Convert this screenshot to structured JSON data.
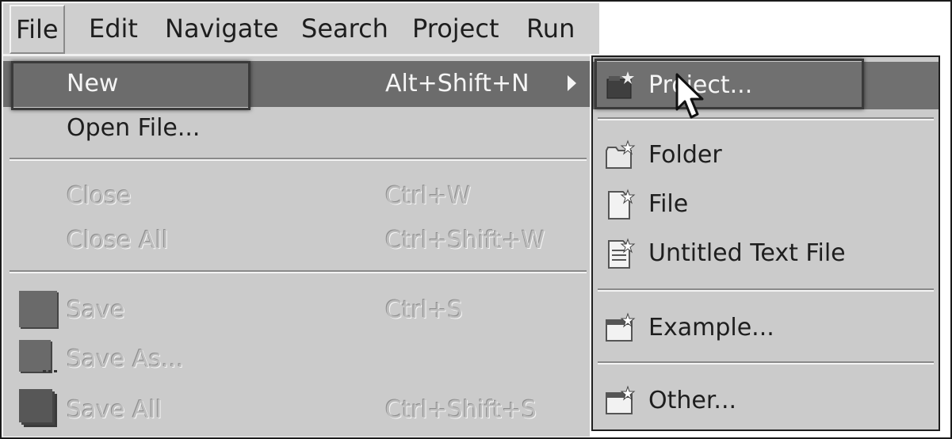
{
  "menubar": {
    "items": [
      {
        "label": "File"
      },
      {
        "label": "Edit"
      },
      {
        "label": "Navigate"
      },
      {
        "label": "Search"
      },
      {
        "label": "Project"
      },
      {
        "label": "Run"
      }
    ]
  },
  "file_menu": {
    "items": [
      {
        "label": "New",
        "shortcut": "Alt+Shift+N",
        "state": "highlighted",
        "has_submenu": true
      },
      {
        "label": "Open File...",
        "shortcut": ""
      },
      {
        "label": "Close",
        "shortcut": "Ctrl+W",
        "state": "disabled"
      },
      {
        "label": "Close All",
        "shortcut": "Ctrl+Shift+W",
        "state": "disabled"
      },
      {
        "label": "Save",
        "shortcut": "Ctrl+S",
        "state": "disabled",
        "icon": "save-icon"
      },
      {
        "label": "Save As...",
        "shortcut": "",
        "state": "disabled",
        "icon": "save-as-icon"
      },
      {
        "label": "Save All",
        "shortcut": "Ctrl+Shift+S",
        "state": "disabled",
        "icon": "save-all-icon"
      }
    ]
  },
  "new_submenu": {
    "items": [
      {
        "label": "Project...",
        "icon": "new-project-icon",
        "state": "highlighted"
      },
      {
        "label": "Folder",
        "icon": "new-folder-icon"
      },
      {
        "label": "File",
        "icon": "new-file-icon"
      },
      {
        "label": "Untitled Text File",
        "icon": "new-text-file-icon"
      },
      {
        "label": "Example...",
        "icon": "new-example-icon"
      },
      {
        "label": "Other...",
        "icon": "new-other-icon"
      }
    ]
  },
  "colors": {
    "menu_bg": "#cbcbcb",
    "highlight_bg": "#6c6c6c",
    "disabled_text": "#bdbdbd"
  }
}
